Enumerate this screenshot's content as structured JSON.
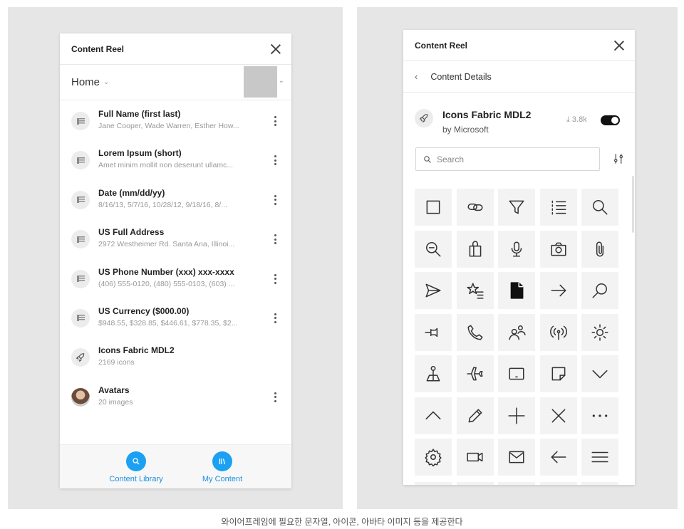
{
  "left_panel": {
    "title": "Content Reel",
    "breadcrumb": "Home",
    "items": [
      {
        "name": "Full Name (first last)",
        "sub": "Jane Cooper, Wade Warren, Esther How...",
        "icon": "text-lines-icon"
      },
      {
        "name": "Lorem Ipsum (short)",
        "sub": "Amet minim mollit non deserunt ullamc...",
        "icon": "text-lines-icon"
      },
      {
        "name": "Date (mm/dd/yy)",
        "sub": "8/16/13, 5/7/16, 10/28/12, 9/18/16, 8/...",
        "icon": "text-lines-icon"
      },
      {
        "name": "US Full Address",
        "sub": "2972 Westheimer Rd. Santa Ana, Illinoi...",
        "icon": "text-lines-icon"
      },
      {
        "name": "US Phone Number (xxx) xxx-xxxx",
        "sub": "(406) 555-0120, (480) 555-0103, (603) ...",
        "icon": "text-lines-icon"
      },
      {
        "name": "US Currency ($000.00)",
        "sub": "$948.55, $328.85, $446.61, $778.35, $2...",
        "icon": "text-lines-icon"
      },
      {
        "name": "Icons Fabric MDL2",
        "sub": "2169 icons",
        "icon": "rocket-icon"
      },
      {
        "name": "Avatars",
        "sub": "20 images",
        "icon": "avatar-photo"
      }
    ],
    "nav": [
      {
        "label": "Content Library",
        "icon": "search-icon"
      },
      {
        "label": "My Content",
        "icon": "library-icon"
      }
    ]
  },
  "right_panel": {
    "title": "Content Reel",
    "back_label": "Content Details",
    "pack_name": "Icons Fabric MDL2",
    "pack_author": "by Microsoft",
    "downloads": "3.8k",
    "search_placeholder": "Search",
    "icons": [
      "checkbox",
      "link",
      "filter",
      "bulleted-list",
      "search",
      "zoom-out",
      "shopping-bag",
      "microphone",
      "camera",
      "attach",
      "send",
      "favorite-list",
      "page-solid",
      "forward",
      "search-handle",
      "pin",
      "phone",
      "people",
      "radio-broadcast",
      "brightness",
      "map-pin",
      "airplane",
      "tablet",
      "sticky-note",
      "chevron-down",
      "chevron-up",
      "edit-pencil",
      "add",
      "cancel",
      "more",
      "settings",
      "video",
      "mail",
      "back",
      "menu"
    ]
  },
  "caption": "와이어프레임에 필요한 문자열, 아이콘, 아바타 이미지 등을 제공한다",
  "colors": {
    "accent": "#1ca0f2",
    "background": "#e6e6e6"
  }
}
